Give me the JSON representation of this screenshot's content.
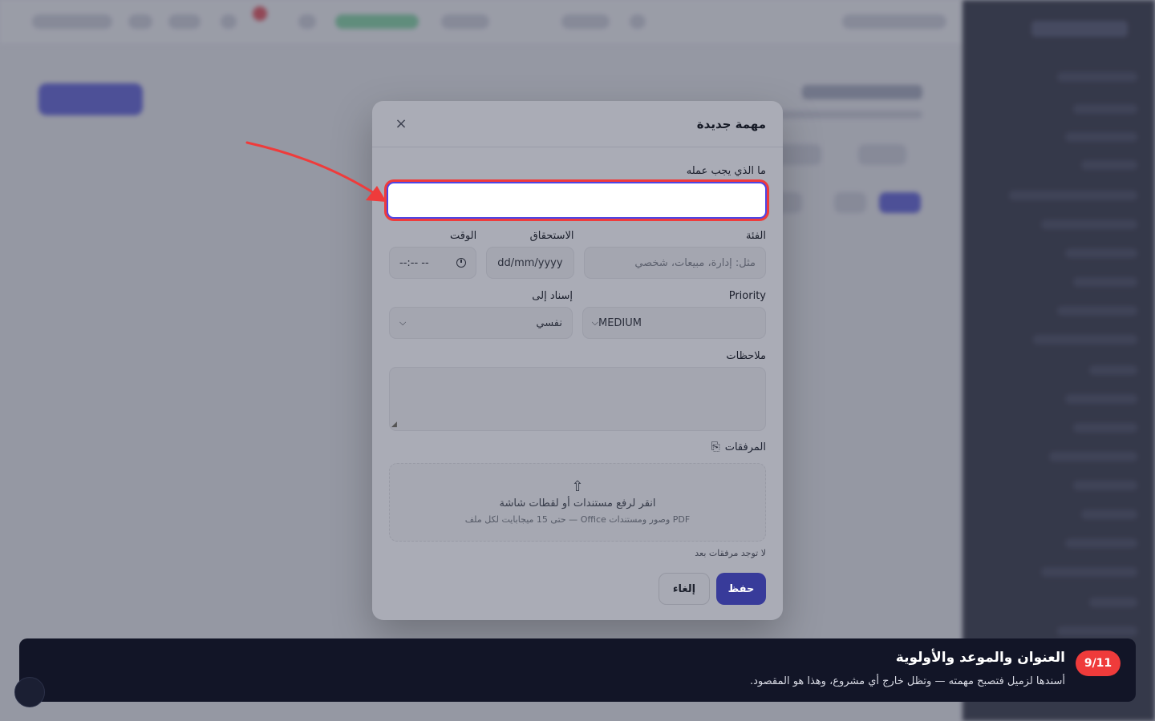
{
  "modal": {
    "title": "مهمة جديدة",
    "close_symbol": "×",
    "task_label": "ما الذي يجب عمله",
    "task_value": "",
    "category_label": "الفئة",
    "category_placeholder": "مثل: إدارة، مبيعات، شخصي",
    "due_label": "الاستحقاق",
    "due_placeholder": "dd/mm/yyyy",
    "time_label": "الوقت",
    "time_placeholder": "--:-- --",
    "priority_label": "Priority",
    "priority_value": "MEDIUM",
    "assign_label": "إسناد إلى",
    "assign_value": "نفسي",
    "notes_label": "ملاحظات",
    "attachments_label": "المرفقات",
    "upload_title": "انقر لرفع مستندات أو لقطات شاشة",
    "upload_hint": "PDF وصور ومستندات Office — حتى 15 ميجابايت لكل ملف",
    "no_attachments": "لا توجد مرفقات بعد",
    "save_label": "حفظ",
    "cancel_label": "إلغاء"
  },
  "tour": {
    "step": "9/11",
    "title": "العنوان والموعد والأولوية",
    "description": "أسندها لزميل فتصبح مهمته — وتظل خارج أي مشروع، وهذا هو المقصود."
  },
  "icons": {
    "close": "close-icon",
    "clock": "clock-icon",
    "chevron": "chevron-down-icon",
    "paperclip": "paperclip-icon",
    "upload": "upload-cloud-icon"
  },
  "colors": {
    "accent": "#4f46e5",
    "highlight": "#ef3b3b",
    "tour_bg": "#121527"
  }
}
